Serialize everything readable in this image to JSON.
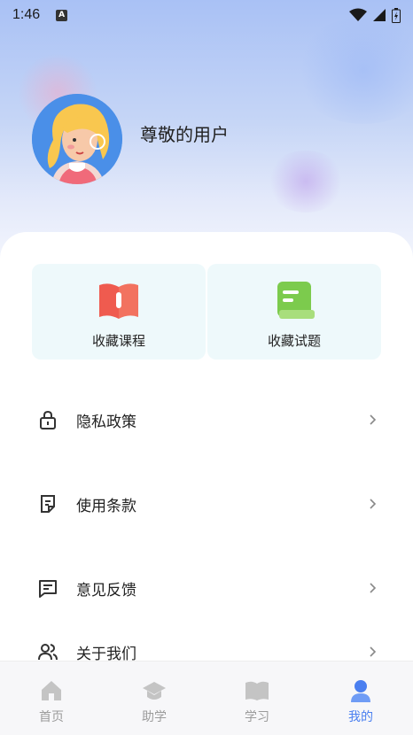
{
  "status_bar": {
    "time": "1:46",
    "notification_letter": "A"
  },
  "profile": {
    "username": "尊敬的用户"
  },
  "favorites": [
    {
      "label": "收藏课程",
      "icon": "open-book-icon"
    },
    {
      "label": "收藏试题",
      "icon": "notebook-icon"
    }
  ],
  "menu": [
    {
      "label": "隐私政策",
      "icon": "lock-icon"
    },
    {
      "label": "使用条款",
      "icon": "document-icon"
    },
    {
      "label": "意见反馈",
      "icon": "chat-icon"
    },
    {
      "label": "关于我们",
      "icon": "users-icon"
    }
  ],
  "tabbar": {
    "tabs": [
      {
        "label": "首页",
        "icon": "home-icon"
      },
      {
        "label": "助学",
        "icon": "graduation-cap-icon"
      },
      {
        "label": "学习",
        "icon": "book-icon"
      },
      {
        "label": "我的",
        "icon": "person-icon"
      }
    ],
    "active_index": 3
  },
  "colors": {
    "accent": "#4a7ff0",
    "inactive": "#c4c4c4",
    "fav_card_bg": "#eef9fb",
    "course_icon": "#ef5b4f",
    "question_icon": "#7ccb4d"
  }
}
